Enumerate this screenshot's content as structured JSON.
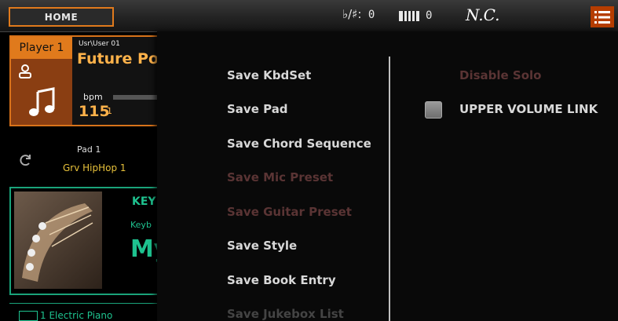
{
  "topbar": {
    "home_label": "HOME",
    "transpose_symbol": "♭/♯:",
    "transpose_value": "0",
    "keyboard_icon": "keyboard-icon",
    "octave_value": "0",
    "chord": "N.C.",
    "menu_icon": "list-menu-icon",
    "accent_color": "#e07a1c"
  },
  "player": {
    "tab_label": "Player 1",
    "user_path": "Usr\\User 01",
    "song_title": "Future Pop",
    "bpm_label": "bpm",
    "bpm_value": "115",
    "bpm_sub": "1"
  },
  "pad": {
    "label": "Pad 1",
    "name": "Grv HipHop 1"
  },
  "keyboard_set": {
    "title": "KEY",
    "sub": "Keyb",
    "big": "My",
    "sound_number": "1",
    "sound_name": "Electric Piano",
    "color": "#1ec28f"
  },
  "menu": {
    "items": [
      {
        "label": "Save KbdSet",
        "state": "enabled"
      },
      {
        "label": "Save Pad",
        "state": "enabled"
      },
      {
        "label": "Save Chord Sequence",
        "state": "enabled"
      },
      {
        "label": "Save Mic Preset",
        "state": "disabled"
      },
      {
        "label": "Save Guitar Preset",
        "state": "disabled"
      },
      {
        "label": "Save Style",
        "state": "enabled"
      },
      {
        "label": "Save Book Entry",
        "state": "enabled"
      },
      {
        "label": "Save Jukebox List",
        "state": "faded"
      }
    ],
    "right": {
      "disable_solo": "Disable Solo",
      "upper_volume_link": "UPPER VOLUME LINK",
      "upper_volume_link_checked": false
    }
  }
}
